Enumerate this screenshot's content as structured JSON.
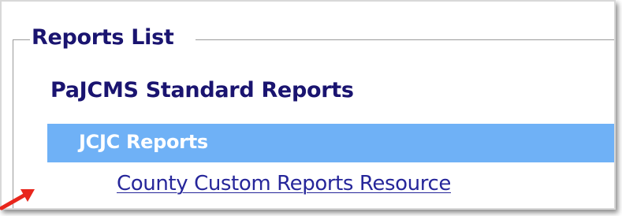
{
  "reports_panel": {
    "legend": "Reports List",
    "group_heading": "PaJCMS Standard Reports",
    "category": {
      "label": "JCJC Reports",
      "background_color": "#6fb1f6"
    },
    "links": [
      {
        "label": "County Custom Reports Resource"
      }
    ]
  },
  "annotation": {
    "icon": "red-arrow-icon",
    "color": "#e8261c"
  },
  "colors": {
    "heading_text": "#1a1470",
    "link_text": "#26269a"
  }
}
